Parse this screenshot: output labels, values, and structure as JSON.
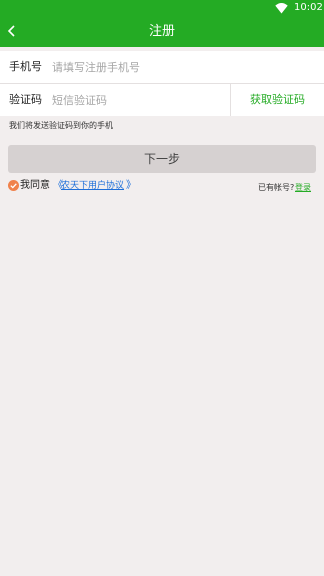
{
  "status_bar": {
    "time": "10:02",
    "wifi_icon": "wifi-icon"
  },
  "header": {
    "title": "注册",
    "back_icon": "back-arrow-icon"
  },
  "form": {
    "phone": {
      "label": "手机号",
      "placeholder": "请填写注册手机号",
      "value": ""
    },
    "code": {
      "label": "验证码",
      "placeholder": "短信验证码",
      "value": "",
      "button_label": "获取验证码"
    }
  },
  "hint": "我们将发送验证码到你的手机",
  "next_button": "下一步",
  "agreement": {
    "checked": true,
    "prefix": "我同意",
    "open_bracket": "《",
    "link": "农天下用户协议",
    "close_bracket": "》"
  },
  "account": {
    "text": "已有帐号?",
    "login": "登录"
  },
  "colors": {
    "brand_green": "#24ab24",
    "background": "#f2eeee",
    "check_orange": "#f0814b",
    "link_blue": "#1e6fd9"
  }
}
